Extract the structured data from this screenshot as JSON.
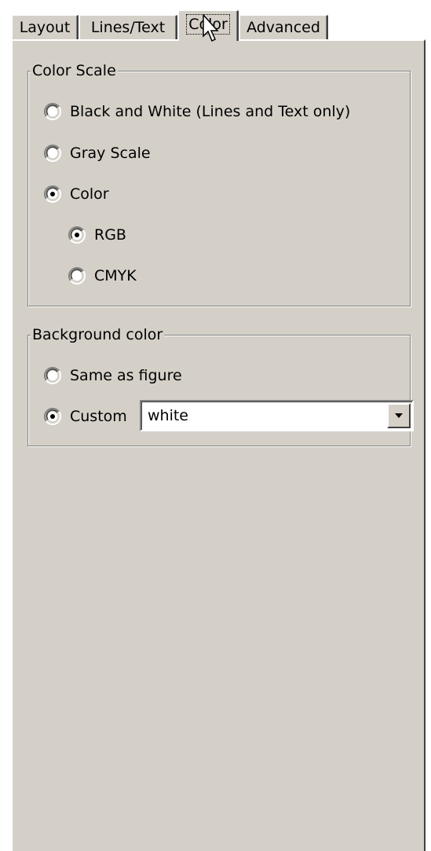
{
  "tabs": [
    {
      "label": "Layout",
      "active": false
    },
    {
      "label": "Lines/Text",
      "active": false
    },
    {
      "label": "Color",
      "active": true
    },
    {
      "label": "Advanced",
      "active": false
    }
  ],
  "color_scale": {
    "title": "Color Scale",
    "options": [
      {
        "label": "Black and White (Lines and Text only)",
        "selected": false
      },
      {
        "label": "Gray Scale",
        "selected": false
      },
      {
        "label": "Color",
        "selected": true
      }
    ],
    "sub_options": [
      {
        "label": "RGB",
        "selected": true
      },
      {
        "label": "CMYK",
        "selected": false
      }
    ]
  },
  "background_color": {
    "title": "Background color",
    "options": [
      {
        "label": "Same as figure",
        "selected": false
      },
      {
        "label": "Custom",
        "selected": true
      }
    ],
    "custom_value": "white"
  },
  "icons": {
    "radio": "radio-button-icon",
    "dropdown": "chevron-down-icon",
    "cursor": "mouse-pointer-icon"
  },
  "colors": {
    "face": "#d4d0c8",
    "highlight": "#ffffff",
    "shadow": "#808080",
    "dark_shadow": "#404040"
  }
}
